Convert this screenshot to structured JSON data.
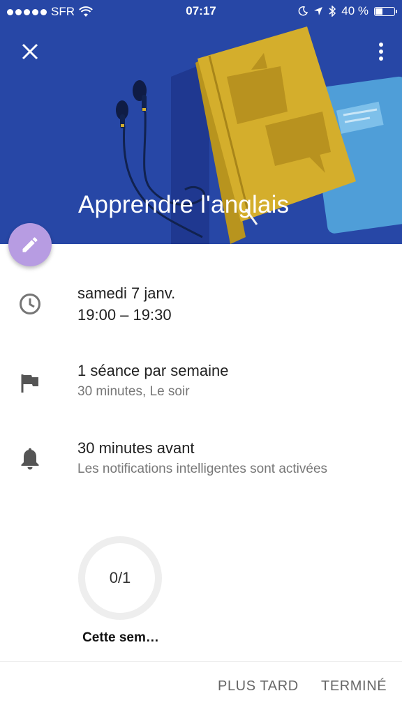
{
  "status_bar": {
    "carrier": "SFR",
    "time": "07:17",
    "battery_text": "40 %",
    "battery_level": 0.4
  },
  "header": {
    "title": "Apprendre l'anglais",
    "background_color": "#2747a6"
  },
  "details": {
    "date": "samedi 7 janv.",
    "time_range": "19:00 – 19:30",
    "frequency": "1 séance par semaine",
    "frequency_detail": "30 minutes, Le soir",
    "notification": "30 minutes avant",
    "notification_detail": "Les notifications intelligentes sont activées"
  },
  "progress": {
    "value": "0/1",
    "fraction": 0,
    "label": "Cette sem…"
  },
  "actions": {
    "later": "PLUS TARD",
    "done": "TERMINÉ"
  },
  "icons": {
    "close": "close-icon",
    "more": "more-vert-icon",
    "edit": "pencil-icon",
    "clock": "clock-icon",
    "flag": "flag-icon",
    "bell": "bell-icon"
  },
  "colors": {
    "accent_fab": "#b79ce2",
    "header_blue": "#2747a6"
  }
}
